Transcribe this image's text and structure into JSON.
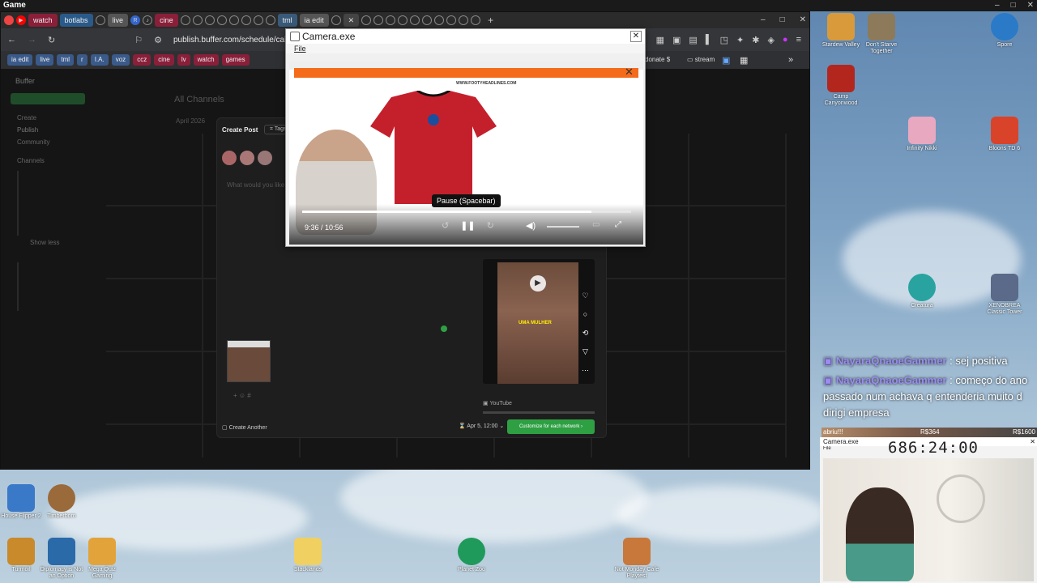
{
  "game_title": "Game",
  "browser": {
    "tabs": [
      "watch",
      "botlabs",
      "live",
      "ia edit",
      "tml",
      "cine"
    ],
    "url": "publish.buffer.com/schedule/calend",
    "bookmarks": [
      "ia edit",
      "live",
      "tml",
      "r",
      "I.A.",
      "voz",
      "ccz",
      "cine",
      "lv",
      "watch",
      "games"
    ],
    "bookmarks_right": [
      "donate $",
      "stream"
    ]
  },
  "buffer": {
    "brand": "Buffer",
    "header": "All Channels",
    "month": "April 2026",
    "sidebar_items": [
      "Create",
      "Publish",
      "Community",
      "Channels",
      "Show less"
    ],
    "modal": {
      "title": "Create Post",
      "tags_label": "Tags",
      "placeholder": "What would you like to share?",
      "create_another": "Create Another",
      "schedule_date": "Apr 5, 12:00",
      "customize_button": "Customize for each network",
      "preview_source": "YouTube",
      "preview_caption": "UMA MULHER"
    }
  },
  "camera": {
    "title": "Camera.exe",
    "menu_file": "File",
    "video_site": "WWW.FOOTYHEADLINES.COM",
    "tooltip": "Pause (Spacebar)",
    "time": "9:36 / 10:56",
    "progress": 0.88
  },
  "chat": [
    {
      "user": "NayaraQnaoeGammer",
      "text": "sej positiva"
    },
    {
      "user": "NayaraQnaoeGammer",
      "text": "começo do ano passado num achava q entenderia muito d dirigi empresa"
    }
  ],
  "overlay": {
    "goal_label": "abriu!!!",
    "left_amount": "R$364",
    "right_amount": "R$1600",
    "timer": "686:24:00"
  },
  "camera2": {
    "title": "Camera.exe",
    "menu_file": "File"
  },
  "desktop_icons": {
    "right": [
      "Stardew Valley",
      "Don't Starve Together",
      "Spore",
      "Camp Canyonwood",
      "Infinity Nikki",
      "Bloons TD 6",
      "Creatura",
      "XENOBREA Classic Tower"
    ],
    "bottom": [
      "House Flipper 2",
      "Timberborn",
      "Turmoil",
      "Diplomacy is Not an Option",
      "Mega Quiz Gaming",
      "Stacklands",
      "Planet Zoo",
      "Not Monday Cafe Playtest"
    ]
  },
  "colors": {
    "buffer_green": "#2ea043",
    "chat_name": "#9b8cf0",
    "youtube_red": "#ff0000"
  }
}
